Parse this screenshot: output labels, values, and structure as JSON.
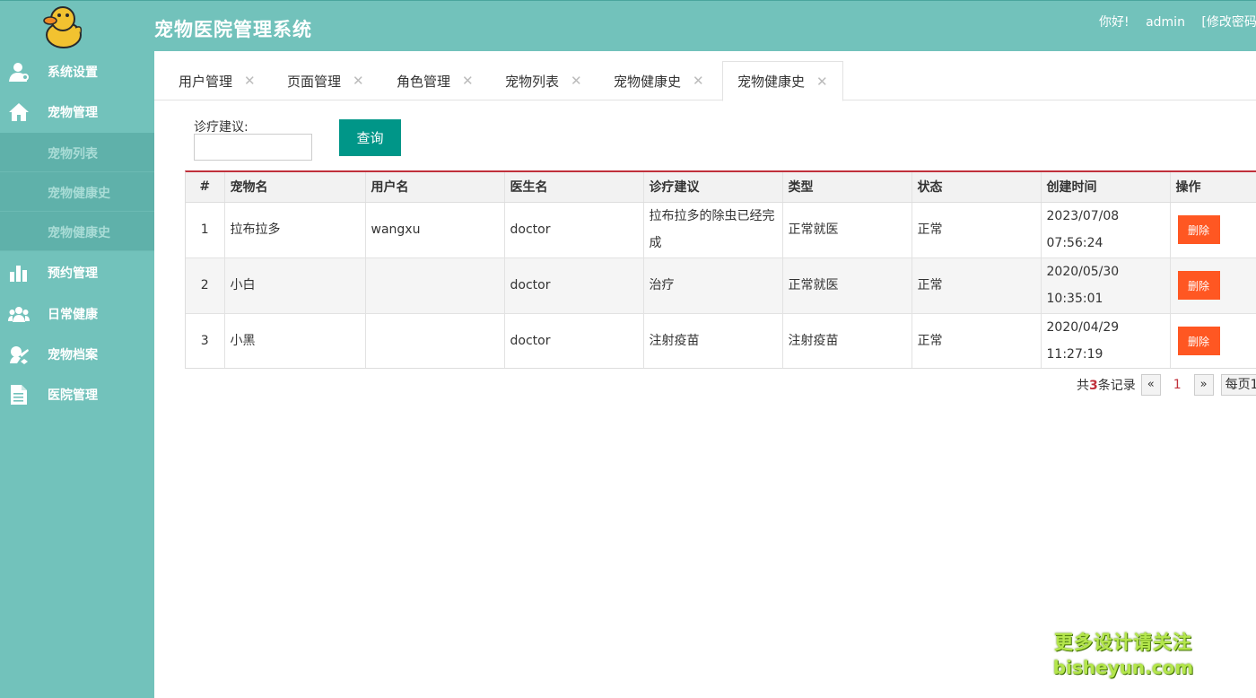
{
  "header": {
    "title": "宠物医院管理系统",
    "greeting": "你好!",
    "username": "admin",
    "change_password": "[修改密码"
  },
  "sidebar": {
    "items": [
      {
        "label": "系统设置",
        "icon": "user-gear-icon"
      },
      {
        "label": "宠物管理",
        "icon": "home-icon"
      },
      {
        "label": "预约管理",
        "icon": "bar-chart-icon"
      },
      {
        "label": "日常健康",
        "icon": "group-icon"
      },
      {
        "label": "宠物档案",
        "icon": "archive-icon"
      },
      {
        "label": "医院管理",
        "icon": "document-icon"
      }
    ],
    "subitems": [
      "宠物列表",
      "宠物健康史",
      "宠物健康史"
    ]
  },
  "tabs": [
    {
      "label": "用户管理"
    },
    {
      "label": "页面管理"
    },
    {
      "label": "角色管理"
    },
    {
      "label": "宠物列表"
    },
    {
      "label": "宠物健康史"
    },
    {
      "label": "宠物健康史"
    }
  ],
  "filter": {
    "label": "诊疗建议:",
    "value": "",
    "query_label": "查询"
  },
  "table": {
    "headers": [
      "#",
      "宠物名",
      "用户名",
      "医生名",
      "诊疗建议",
      "类型",
      "状态",
      "创建时间",
      "操作"
    ],
    "rows": [
      {
        "no": "1",
        "pet": "拉布拉多",
        "user": "wangxu",
        "doctor": "doctor",
        "advice": "拉布拉多的除虫已经完成",
        "type": "正常就医",
        "status": "正常",
        "created": "2023/07/08 07:56:24",
        "action": "删除"
      },
      {
        "no": "2",
        "pet": "小白",
        "user": "",
        "doctor": "doctor",
        "advice": "治疗",
        "type": "正常就医",
        "status": "正常",
        "created": "2020/05/30 10:35:01",
        "action": "删除"
      },
      {
        "no": "3",
        "pet": "小黑",
        "user": "",
        "doctor": "doctor",
        "advice": "注射疫苗",
        "type": "注射疫苗",
        "status": "正常",
        "created": "2020/04/29 11:27:19",
        "action": "删除"
      }
    ]
  },
  "pager": {
    "prefix": "共",
    "count": "3",
    "suffix": "条记录",
    "prev": "«",
    "current": "1",
    "next": "»",
    "page_size": "每页1"
  },
  "watermark": {
    "line1": "更多设计请关注",
    "line2": "bisheyun.com"
  },
  "colors": {
    "theme": "#72c2bb",
    "primary_button": "#009688",
    "danger_button": "#ff5722",
    "accent_red": "#c0303b"
  }
}
